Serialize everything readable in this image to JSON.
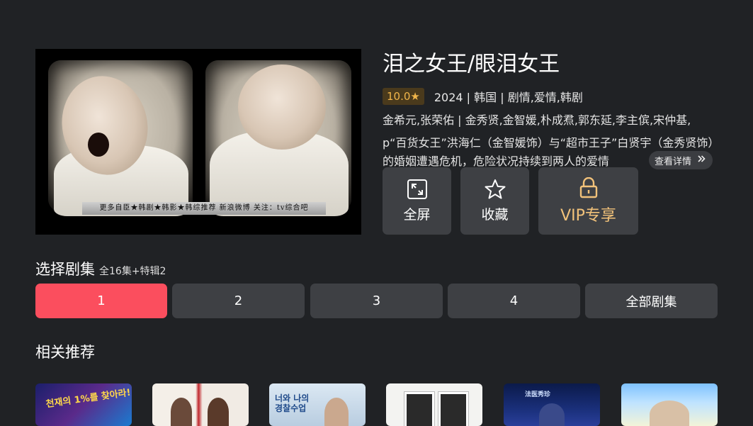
{
  "video": {
    "subtitle": "更多自臣★韩剧★韩影★韩综推荐 新浪微博 关注：tv综合吧"
  },
  "detail": {
    "title": "泪之女王/眼泪女王",
    "rating": "10.0★",
    "meta": "2024 | 韩国 | 剧情,爱情,韩剧",
    "cast": "金希元,张荣佑 | 金秀贤,金智媛,朴成焄,郭东延,李主傧,宋仲基,",
    "description": "p“百货女王”洪海仁（金智媛饰）与“超市王子”白贤宇（金秀贤饰）的婚姻遭遇危机，危险状况持续到两人的爱情",
    "more_label": "查看详情",
    "more_icon": "double-chevron-right-icon"
  },
  "actions": [
    {
      "label": "全屏",
      "icon": "fullscreen-icon"
    },
    {
      "label": "收藏",
      "icon": "star-icon"
    },
    {
      "label": "VIP专享",
      "icon": "lock-icon",
      "color": "#f2c27a"
    }
  ],
  "episodes": {
    "title": "选择剧集",
    "summary": "全16集+特辑2",
    "items": [
      "1",
      "2",
      "3",
      "4"
    ],
    "all_label": "全部剧集",
    "active_index": 0,
    "active_color": "#fb4e5e"
  },
  "recommend": {
    "title": "相关推荐",
    "posters": [
      {
        "text": "천재의 1%를 찾아라!"
      },
      {
        "text": ""
      },
      {
        "text": "너와 나의 경찰수업"
      },
      {
        "text": ""
      },
      {
        "text": "法医秀珍"
      },
      {
        "text": ""
      }
    ]
  }
}
